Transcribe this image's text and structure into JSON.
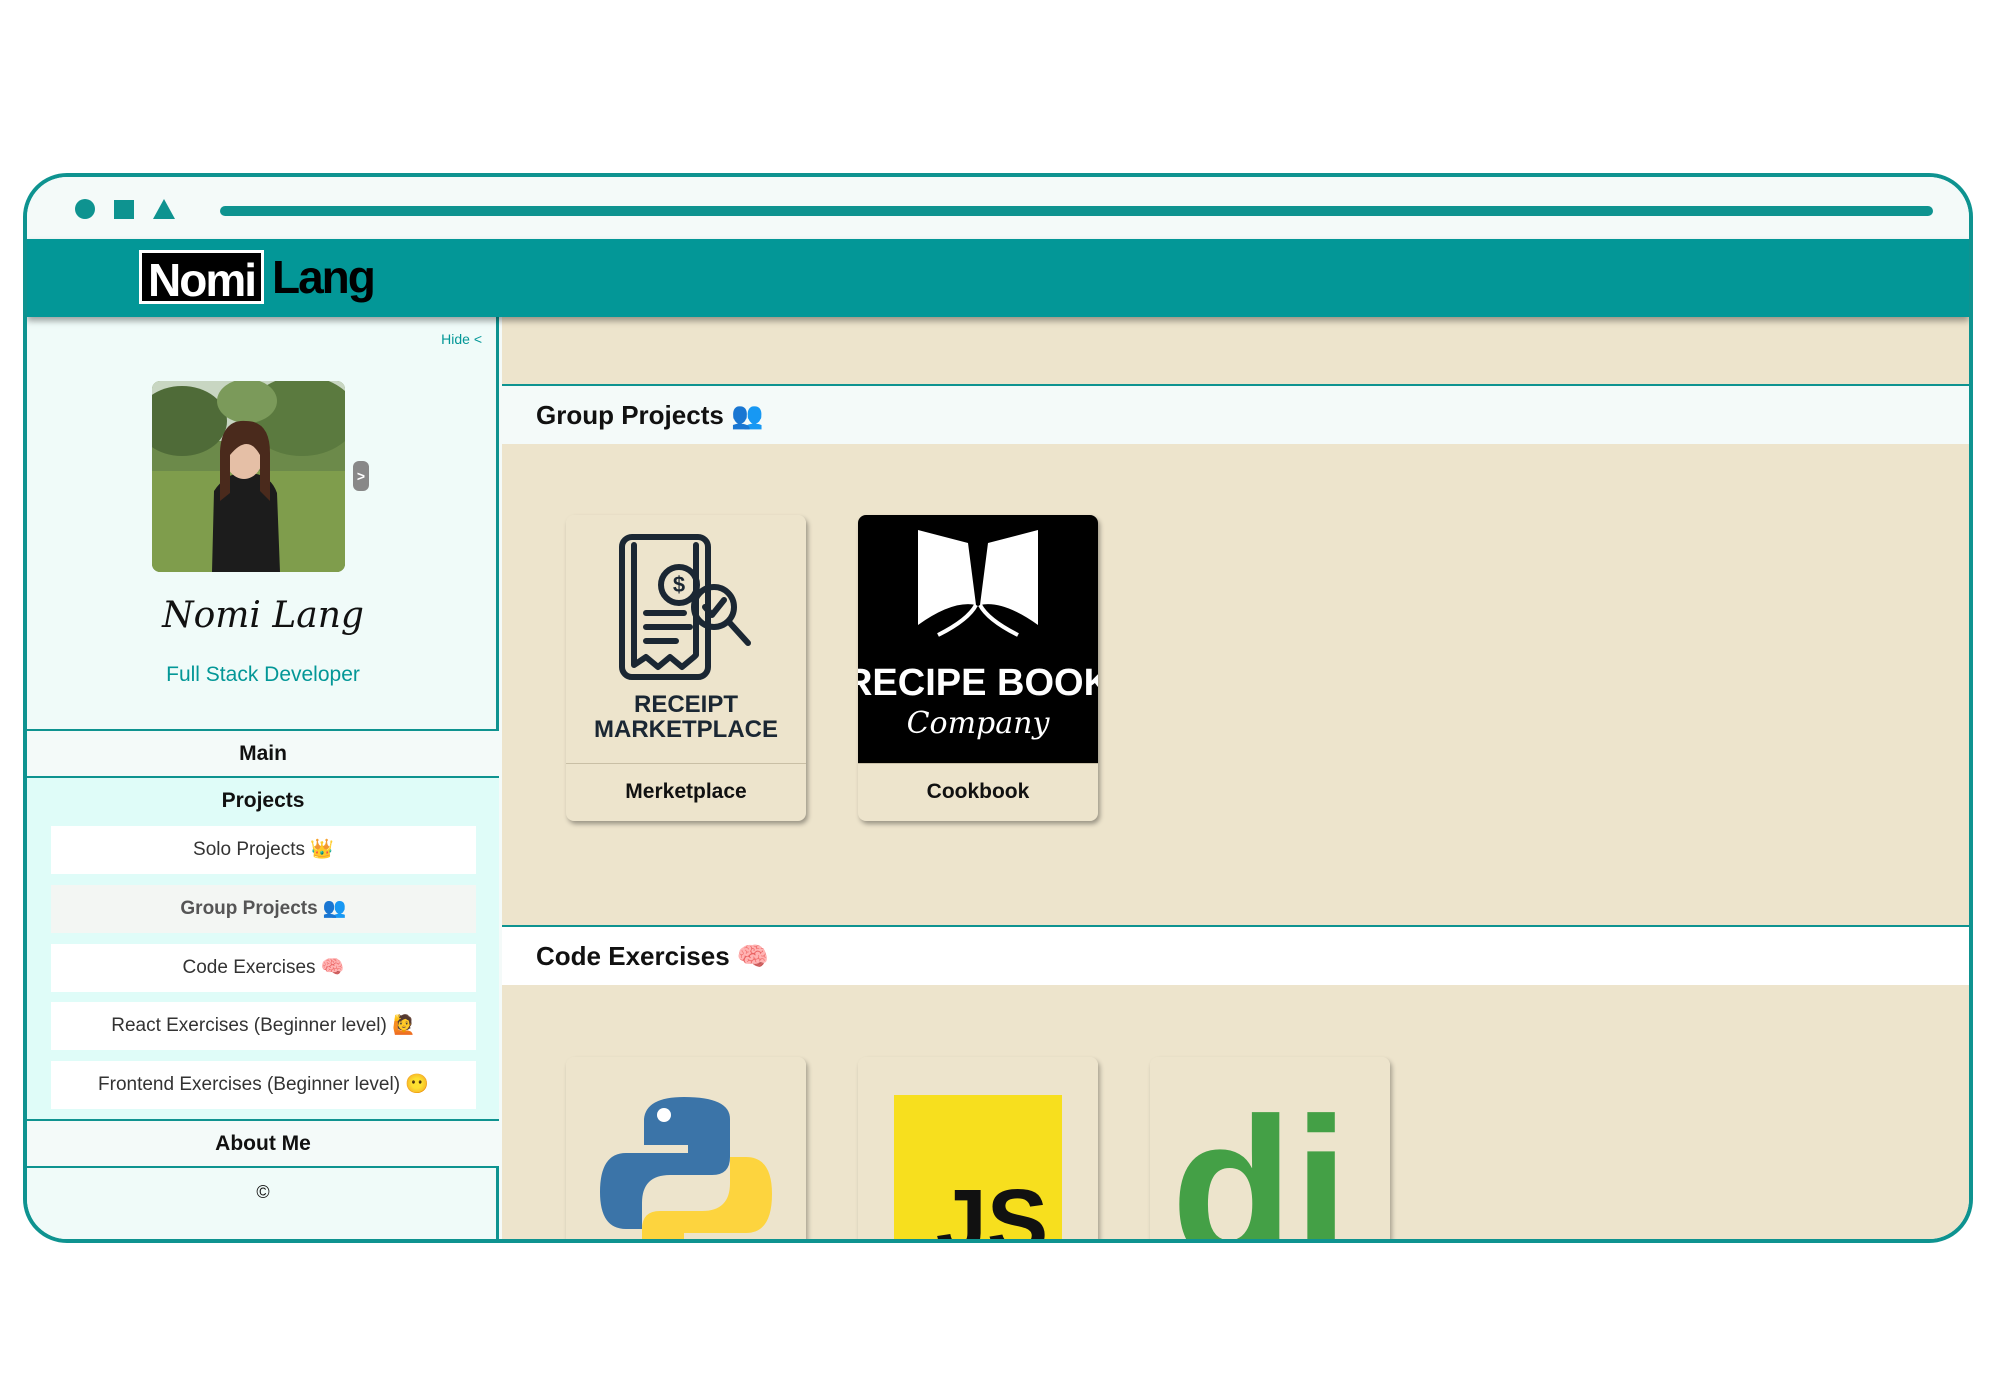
{
  "brand": {
    "logo_box": "Nomi",
    "logo_text": "Lang"
  },
  "sidebar": {
    "hide_link": "Hide <",
    "avatar_toggle": ">",
    "name": "Nomi Lang",
    "role": "Full Stack Developer",
    "nav": {
      "main": "Main",
      "projects": "Projects",
      "about": "About Me"
    },
    "project_items": [
      {
        "label": "Solo Projects 👑"
      },
      {
        "label": "Group Projects 👥"
      },
      {
        "label": "Code Exercises 🧠"
      },
      {
        "label": "React Exercises (Beginner level) 🙋"
      },
      {
        "label": "Frontend Exercises (Beginner level) 😶"
      }
    ],
    "copyright": "©"
  },
  "main": {
    "group_projects": {
      "title": "Group Projects 👥",
      "cards": [
        {
          "label": "Merketplace",
          "image_text": [
            "RECEIPT",
            "MARKETPLACE"
          ]
        },
        {
          "label": "Cookbook",
          "image_text": [
            "RECIPE BOOK",
            "Company"
          ]
        }
      ]
    },
    "code_exercises": {
      "title": "Code Exercises 🧠",
      "cards": [
        {
          "icon": "python-logo-icon"
        },
        {
          "icon": "javascript-logo-icon",
          "image_text": "JS"
        },
        {
          "icon": "django-logo-icon",
          "image_text": "dj"
        }
      ]
    }
  },
  "colors": {
    "accent": "#039797",
    "content_bg": "#ede4cc",
    "sidebar_bg": "#f0fbf9",
    "projects_bg": "#dffcf8"
  }
}
